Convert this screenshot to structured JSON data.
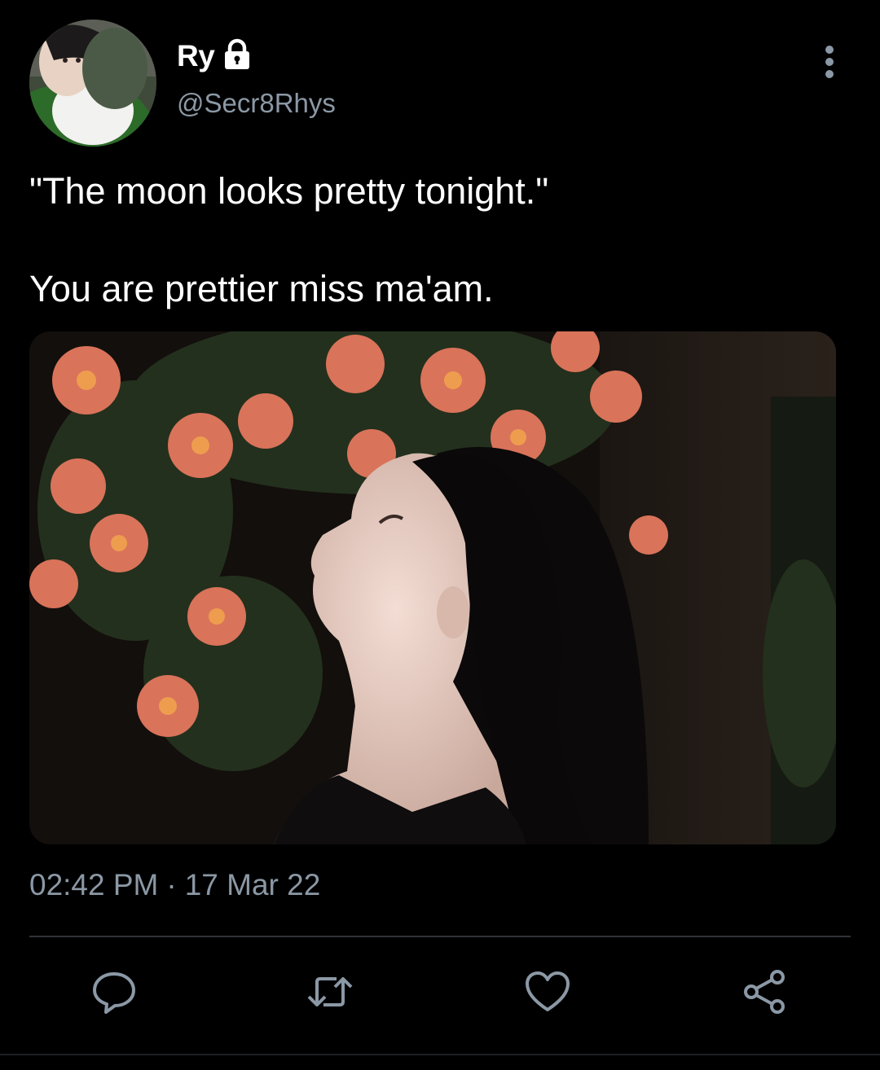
{
  "tweet": {
    "author": {
      "display_name": "Ry",
      "handle": "@Secr8Rhys",
      "protected_icon": "lock-icon"
    },
    "text_lines": [
      "\"The moon looks pretty tonight.\"",
      "You are prettier miss ma'am."
    ],
    "time": "02:42 PM",
    "separator": "·",
    "date": "17 Mar 22"
  },
  "icons": {
    "more": "more-vertical-icon",
    "reply": "reply-icon",
    "retweet": "retweet-icon",
    "like": "heart-icon",
    "share": "share-icon"
  },
  "colors": {
    "background": "#000000",
    "text": "#ffffff",
    "secondary_text": "#8b98a5",
    "icon": "#8b98a5",
    "divider": "#2f3336"
  }
}
